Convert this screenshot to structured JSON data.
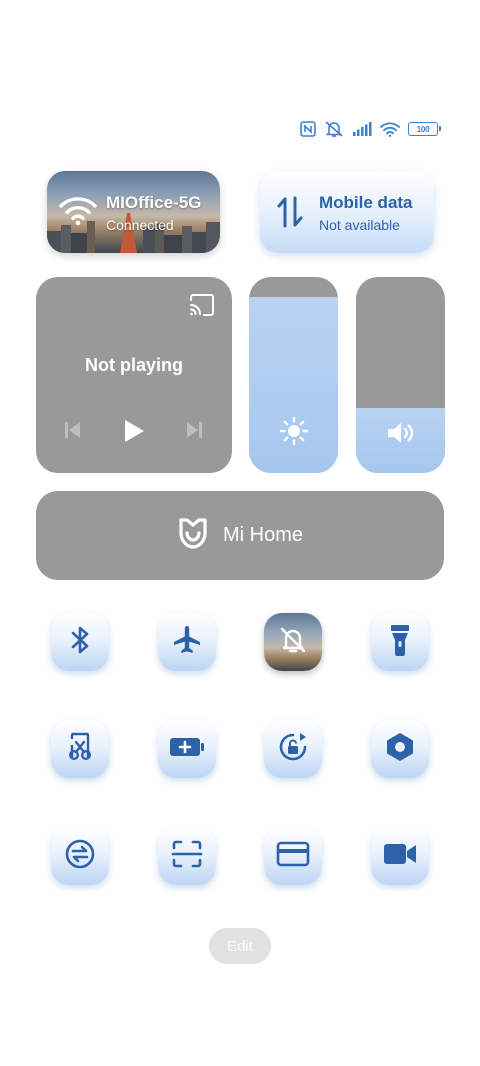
{
  "status_bar": {
    "icons": [
      "nfc-icon",
      "muted-bell-icon",
      "signal-icon",
      "wifi-icon"
    ],
    "battery": "100"
  },
  "wifi": {
    "ssid": "MIOffice-5G",
    "status": "Connected"
  },
  "mobile_data": {
    "title": "Mobile data",
    "status": "Not available"
  },
  "media": {
    "status": "Not playing"
  },
  "sliders": {
    "brightness_level": 0.9,
    "volume_level": 0.33
  },
  "mi_home": {
    "label": "Mi Home"
  },
  "toggles": [
    [
      "bluetooth-icon",
      "airplane-icon",
      "do-not-disturb-icon",
      "flashlight-icon"
    ],
    [
      "screenshot-scissors-icon",
      "battery-saver-icon",
      "rotation-lock-icon",
      "hexagon-settings-icon"
    ],
    [
      "data-saver-icon",
      "scanner-icon",
      "card-icon",
      "video-camera-icon"
    ]
  ],
  "edit": {
    "label": "Edit"
  },
  "colors": {
    "accent": "#2d62a8",
    "tile_gray": "#999999",
    "slider_fill": "#a6c7ee"
  }
}
